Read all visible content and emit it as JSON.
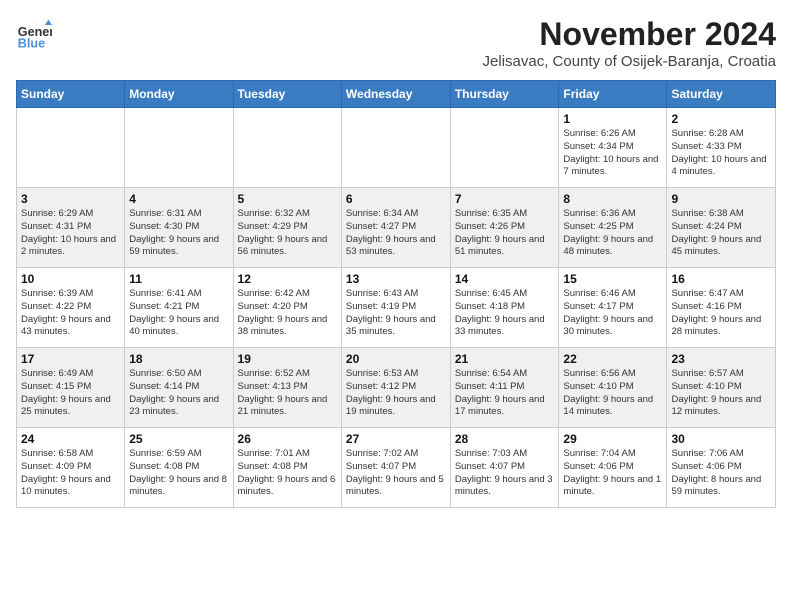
{
  "header": {
    "logo_line1": "General",
    "logo_line2": "Blue",
    "month_title": "November 2024",
    "subtitle": "Jelisavac, County of Osijek-Baranja, Croatia"
  },
  "columns": [
    "Sunday",
    "Monday",
    "Tuesday",
    "Wednesday",
    "Thursday",
    "Friday",
    "Saturday"
  ],
  "weeks": [
    {
      "days": [
        {
          "num": "",
          "info": ""
        },
        {
          "num": "",
          "info": ""
        },
        {
          "num": "",
          "info": ""
        },
        {
          "num": "",
          "info": ""
        },
        {
          "num": "",
          "info": ""
        },
        {
          "num": "1",
          "info": "Sunrise: 6:26 AM\nSunset: 4:34 PM\nDaylight: 10 hours and 7 minutes."
        },
        {
          "num": "2",
          "info": "Sunrise: 6:28 AM\nSunset: 4:33 PM\nDaylight: 10 hours and 4 minutes."
        }
      ]
    },
    {
      "days": [
        {
          "num": "3",
          "info": "Sunrise: 6:29 AM\nSunset: 4:31 PM\nDaylight: 10 hours and 2 minutes."
        },
        {
          "num": "4",
          "info": "Sunrise: 6:31 AM\nSunset: 4:30 PM\nDaylight: 9 hours and 59 minutes."
        },
        {
          "num": "5",
          "info": "Sunrise: 6:32 AM\nSunset: 4:29 PM\nDaylight: 9 hours and 56 minutes."
        },
        {
          "num": "6",
          "info": "Sunrise: 6:34 AM\nSunset: 4:27 PM\nDaylight: 9 hours and 53 minutes."
        },
        {
          "num": "7",
          "info": "Sunrise: 6:35 AM\nSunset: 4:26 PM\nDaylight: 9 hours and 51 minutes."
        },
        {
          "num": "8",
          "info": "Sunrise: 6:36 AM\nSunset: 4:25 PM\nDaylight: 9 hours and 48 minutes."
        },
        {
          "num": "9",
          "info": "Sunrise: 6:38 AM\nSunset: 4:24 PM\nDaylight: 9 hours and 45 minutes."
        }
      ]
    },
    {
      "days": [
        {
          "num": "10",
          "info": "Sunrise: 6:39 AM\nSunset: 4:22 PM\nDaylight: 9 hours and 43 minutes."
        },
        {
          "num": "11",
          "info": "Sunrise: 6:41 AM\nSunset: 4:21 PM\nDaylight: 9 hours and 40 minutes."
        },
        {
          "num": "12",
          "info": "Sunrise: 6:42 AM\nSunset: 4:20 PM\nDaylight: 9 hours and 38 minutes."
        },
        {
          "num": "13",
          "info": "Sunrise: 6:43 AM\nSunset: 4:19 PM\nDaylight: 9 hours and 35 minutes."
        },
        {
          "num": "14",
          "info": "Sunrise: 6:45 AM\nSunset: 4:18 PM\nDaylight: 9 hours and 33 minutes."
        },
        {
          "num": "15",
          "info": "Sunrise: 6:46 AM\nSunset: 4:17 PM\nDaylight: 9 hours and 30 minutes."
        },
        {
          "num": "16",
          "info": "Sunrise: 6:47 AM\nSunset: 4:16 PM\nDaylight: 9 hours and 28 minutes."
        }
      ]
    },
    {
      "days": [
        {
          "num": "17",
          "info": "Sunrise: 6:49 AM\nSunset: 4:15 PM\nDaylight: 9 hours and 25 minutes."
        },
        {
          "num": "18",
          "info": "Sunrise: 6:50 AM\nSunset: 4:14 PM\nDaylight: 9 hours and 23 minutes."
        },
        {
          "num": "19",
          "info": "Sunrise: 6:52 AM\nSunset: 4:13 PM\nDaylight: 9 hours and 21 minutes."
        },
        {
          "num": "20",
          "info": "Sunrise: 6:53 AM\nSunset: 4:12 PM\nDaylight: 9 hours and 19 minutes."
        },
        {
          "num": "21",
          "info": "Sunrise: 6:54 AM\nSunset: 4:11 PM\nDaylight: 9 hours and 17 minutes."
        },
        {
          "num": "22",
          "info": "Sunrise: 6:56 AM\nSunset: 4:10 PM\nDaylight: 9 hours and 14 minutes."
        },
        {
          "num": "23",
          "info": "Sunrise: 6:57 AM\nSunset: 4:10 PM\nDaylight: 9 hours and 12 minutes."
        }
      ]
    },
    {
      "days": [
        {
          "num": "24",
          "info": "Sunrise: 6:58 AM\nSunset: 4:09 PM\nDaylight: 9 hours and 10 minutes."
        },
        {
          "num": "25",
          "info": "Sunrise: 6:59 AM\nSunset: 4:08 PM\nDaylight: 9 hours and 8 minutes."
        },
        {
          "num": "26",
          "info": "Sunrise: 7:01 AM\nSunset: 4:08 PM\nDaylight: 9 hours and 6 minutes."
        },
        {
          "num": "27",
          "info": "Sunrise: 7:02 AM\nSunset: 4:07 PM\nDaylight: 9 hours and 5 minutes."
        },
        {
          "num": "28",
          "info": "Sunrise: 7:03 AM\nSunset: 4:07 PM\nDaylight: 9 hours and 3 minutes."
        },
        {
          "num": "29",
          "info": "Sunrise: 7:04 AM\nSunset: 4:06 PM\nDaylight: 9 hours and 1 minute."
        },
        {
          "num": "30",
          "info": "Sunrise: 7:06 AM\nSunset: 4:06 PM\nDaylight: 8 hours and 59 minutes."
        }
      ]
    }
  ]
}
